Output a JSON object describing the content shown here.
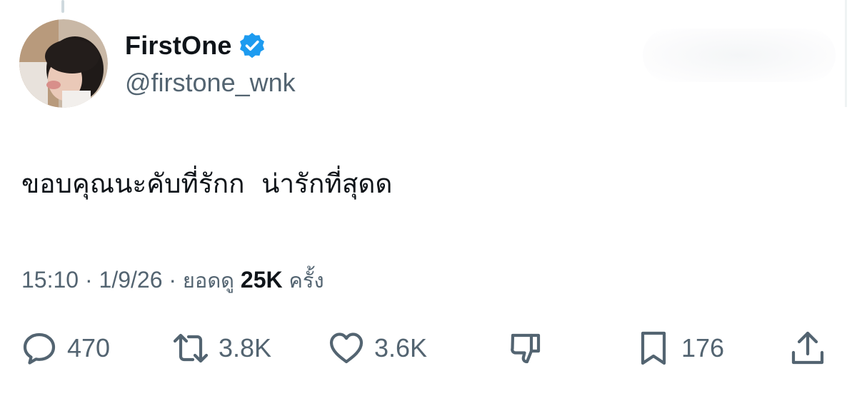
{
  "author": {
    "display_name": "FirstOne",
    "handle": "@firstone_wnk",
    "verified": true,
    "verified_color": "#1d9bf0"
  },
  "tweet": {
    "text": "ขอบคุณนะคับที่รักก  น่ารักที่สุดด"
  },
  "meta": {
    "time": "15:10",
    "date": "1/9/26",
    "views_label": "ยอดดู",
    "views_count": "25K",
    "views_suffix": "ครั้ง",
    "separator": " · "
  },
  "actions": {
    "replies": "470",
    "reposts": "3.8K",
    "likes": "3.6K",
    "bookmarks": "176"
  },
  "icons": [
    "reply-icon",
    "repost-icon",
    "like-icon",
    "dislike-icon",
    "bookmark-icon",
    "share-icon",
    "verified-badge-icon"
  ],
  "colors": {
    "text_primary": "#0f1419",
    "text_secondary": "#536471",
    "verified": "#1d9bf0"
  }
}
